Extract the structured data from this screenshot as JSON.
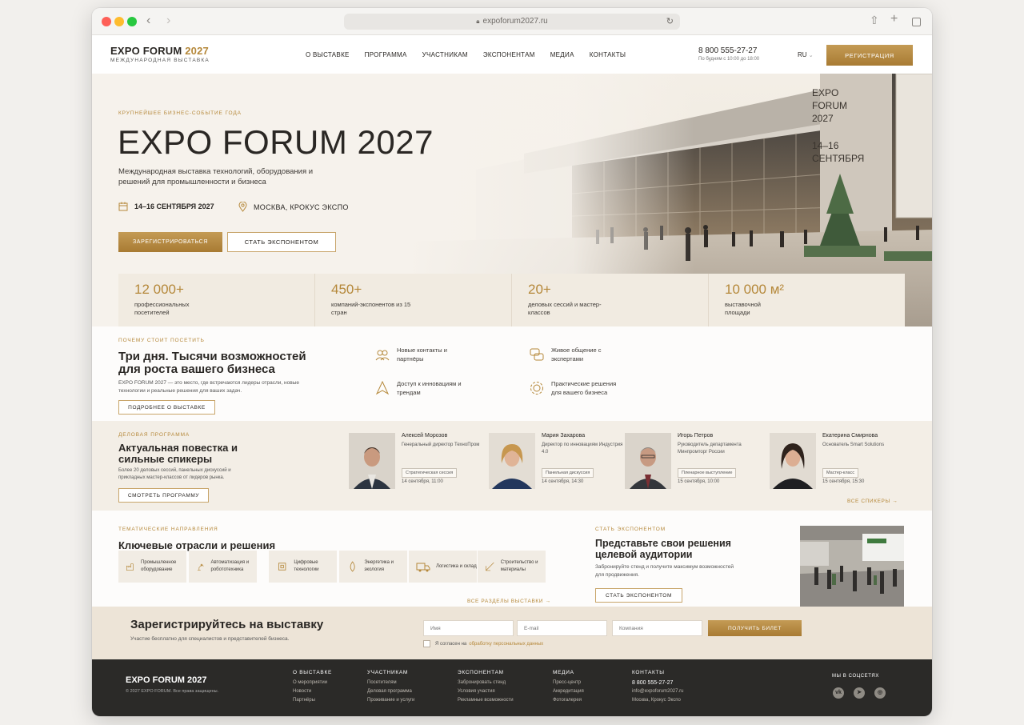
{
  "browser": {
    "url": "expoforum2027.ru"
  },
  "header": {
    "logo_title": "EXPO FORUM",
    "logo_year": "2027",
    "logo_sub": "МЕЖДУНАРОДНАЯ ВЫСТАВКА",
    "nav": [
      "О ВЫСТАВКЕ",
      "ПРОГРАММА",
      "УЧАСТНИКАМ",
      "ЭКСПОНЕНТАМ",
      "МЕДИА",
      "КОНТАКТЫ"
    ],
    "phone": "8 800 555-27-27",
    "phone_hours": "По будням с 10:00 до 18:00",
    "lang": "RU",
    "register": "РЕГИСТРАЦИЯ"
  },
  "hero": {
    "eyebrow": "КРУПНЕЙШЕЕ БИЗНЕС-СОБЫТИЕ ГОДА",
    "title": "EXPO FORUM 2027",
    "desc": "Международная выставка технологий, оборудования и решений для промышленности и бизнеса",
    "date": "14–16 СЕНТЯБРЯ 2027",
    "location": "МОСКВА, КРОКУС ЭКСПО",
    "btn_register": "ЗАРЕГИСТРИРОВАТЬСЯ",
    "btn_exhibitor": "СТАТЬ ЭКСПОНЕНТОМ",
    "banner_l1": "EXPO",
    "banner_l2": "FORUM",
    "banner_l3": "2027",
    "banner_date1": "14–16",
    "banner_date2": "СЕНТЯБРЯ",
    "stats": [
      {
        "value": "12 000+",
        "label": "профессиональных посетителей"
      },
      {
        "value": "450+",
        "label": "компаний-экспонентов из 15 стран"
      },
      {
        "value": "20+",
        "label": "деловых сессий и мастер-классов"
      },
      {
        "value": "10 000 м²",
        "label": "выставочной площади"
      }
    ]
  },
  "why": {
    "eyebrow": "ПОЧЕМУ СТОИТ ПОСЕТИТЬ",
    "title": "Три дня. Тысячи возможностей для роста вашего бизнеса",
    "text": "EXPO FORUM 2027 — это место, где встречаются лидеры отрасли, новые технологии и реальные решения для ваших задач.",
    "btn": "ПОДРОБНЕЕ О ВЫСТАВКЕ",
    "features": [
      {
        "icon": "contacts-icon",
        "label": "Новые контакты и партнёры"
      },
      {
        "icon": "chat-icon",
        "label": "Живое общение с экспертами"
      },
      {
        "icon": "innovation-icon",
        "label": "Доступ к инновациям и трендам"
      },
      {
        "icon": "gear-icon",
        "label": "Практические решения для вашего бизнеса"
      }
    ]
  },
  "program": {
    "eyebrow": "ДЕЛОВАЯ ПРОГРАММА",
    "title": "Актуальная повестка и сильные спикеры",
    "text": "Более 20 деловых сессий, панельных дискуссий и прикладных мастер-классов от лидеров рынка.",
    "btn": "СМОТРЕТЬ ПРОГРАММУ",
    "all_speakers": "ВСЕ СПИКЕРЫ",
    "speakers": [
      {
        "name": "Алексей Морозов",
        "role": "Генеральный директор ТехноПром",
        "tag": "Стратегическая сессия",
        "date": "14 сентября, 11:00"
      },
      {
        "name": "Мария Захарова",
        "role": "Директор по инновациям Индустрия 4.0",
        "tag": "Панельная дискуссия",
        "date": "14 сентября, 14:30"
      },
      {
        "name": "Игорь Петров",
        "role": "Руководитель департамента Минпромторг России",
        "tag": "Пленарное выступление",
        "date": "15 сентября, 10:00"
      },
      {
        "name": "Екатерина Смирнова",
        "role": "Основатель Smart Solutions",
        "tag": "Мастер-класс",
        "date": "15 сентября, 15:30"
      }
    ]
  },
  "directions": {
    "eyebrow": "ТЕМАТИЧЕСКИЕ НАПРАВЛЕНИЯ",
    "title": "Ключевые отрасли и решения",
    "all_link": "ВСЕ РАЗДЕЛЫ ВЫСТАВКИ",
    "tiles": [
      {
        "icon": "factory-icon",
        "label": "Промышленное оборудование"
      },
      {
        "icon": "robot-arm-icon",
        "label": "Автоматизация и робототехника"
      },
      {
        "icon": "chip-icon",
        "label": "Цифровые технологии"
      },
      {
        "icon": "leaf-drop-icon",
        "label": "Энергетика и экология"
      },
      {
        "icon": "truck-icon",
        "label": "Логистика и склад"
      },
      {
        "icon": "ruler-icon",
        "label": "Строительство и материалы"
      }
    ]
  },
  "exhibitor": {
    "eyebrow": "СТАТЬ ЭКСПОНЕНТОМ",
    "title": "Представьте свои решения целевой аудитории",
    "text": "Забронируйте стенд и получите максимум возможностей для продвижения.",
    "btn": "СТАТЬ ЭКСПОНЕНТОМ"
  },
  "registration": {
    "title": "Зарегистрируйтесь на выставку",
    "sub": "Участие бесплатно для специалистов и представителей бизнеса.",
    "ph_name": "Имя",
    "ph_email": "E-mail",
    "ph_company": "Компания",
    "btn": "ПОЛУЧИТЬ БИЛЕТ",
    "agree_text": "Я согласен на",
    "agree_link": "обработку персональных данных"
  },
  "footer": {
    "logo": "EXPO FORUM 2027",
    "copyright": "© 2027 EXPO FORUM. Все права защищены.",
    "columns": [
      {
        "title": "О ВЫСТАВКЕ",
        "items": [
          "О мероприятии",
          "Новости",
          "Партнёры"
        ]
      },
      {
        "title": "УЧАСТНИКАМ",
        "items": [
          "Посетителям",
          "Деловая программа",
          "Проживание и услуги"
        ]
      },
      {
        "title": "ЭКСПОНЕНТАМ",
        "items": [
          "Забронировать стенд",
          "Условия участия",
          "Рекламные возможности"
        ]
      },
      {
        "title": "МЕДИА",
        "items": [
          "Пресс-центр",
          "Аккредитация",
          "Фотогалерея"
        ]
      },
      {
        "title": "КОНТАКТЫ",
        "items": [
          "8 800 555-27-27",
          "info@expoforum2027.ru",
          "Москва, Крокус Экспо"
        ]
      }
    ],
    "social_title": "МЫ В СОЦСЕТЯХ",
    "social": [
      "vk-icon",
      "telegram-icon",
      "ok-icon"
    ],
    "social_glyphs": [
      "vk",
      "➤",
      "◎"
    ]
  },
  "colors": {
    "accent": "#b5883a",
    "footer_bg": "#2b2a28",
    "hero_bg": "#f6f2ec"
  }
}
